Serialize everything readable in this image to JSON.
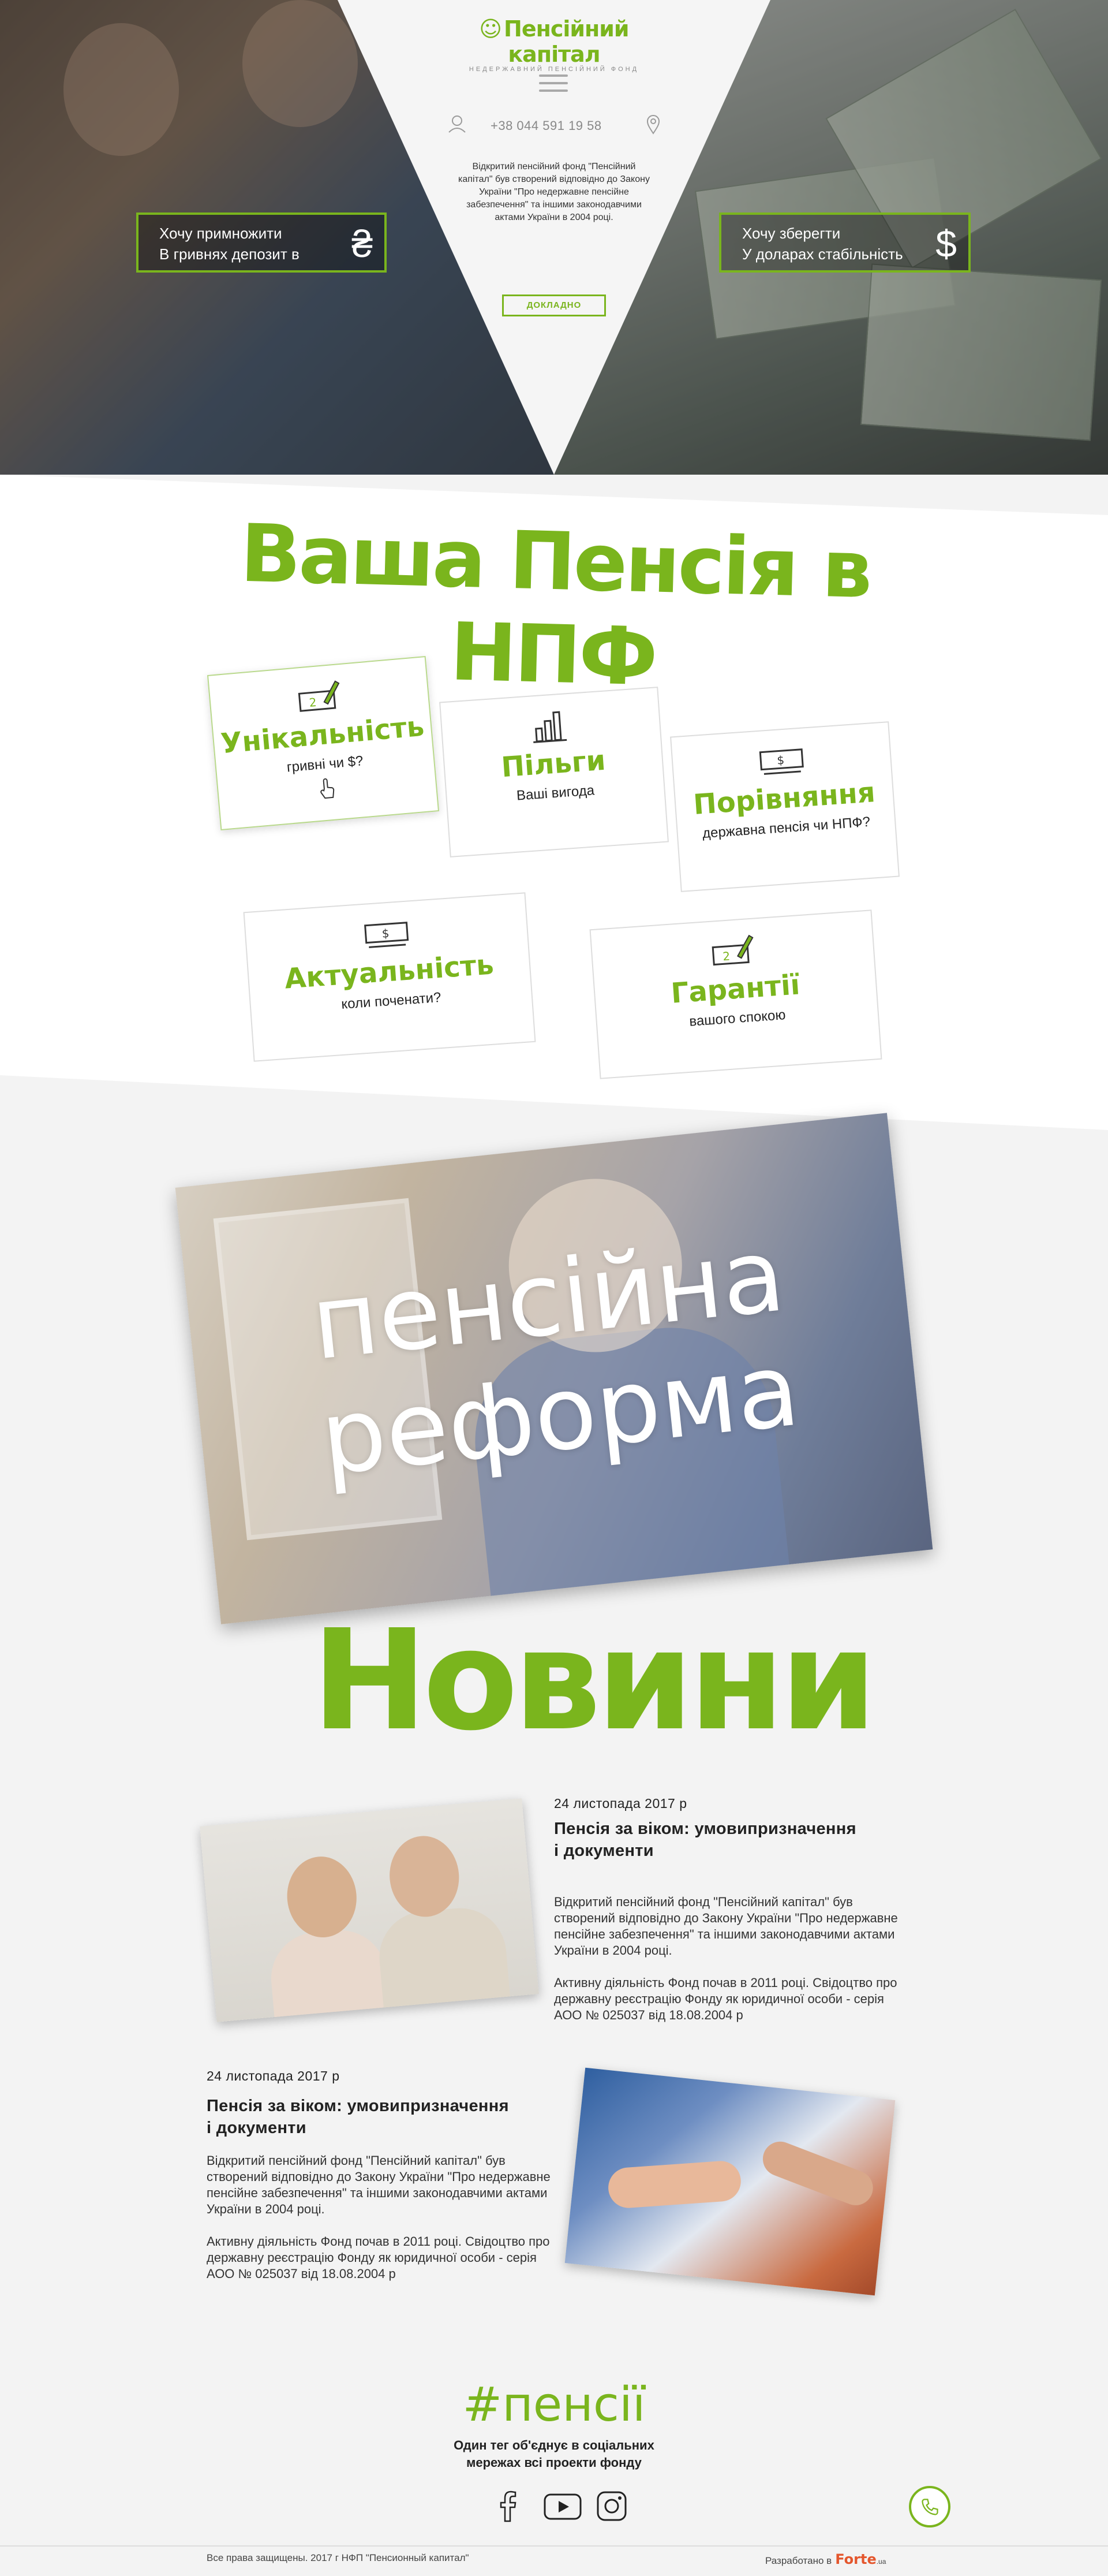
{
  "header": {
    "logo_title": "Пенсійний капітал",
    "logo_subtitle": "НЕДЕРЖАВНИЙ ПЕНСІЙНИЙ ФОНД",
    "phone": "+38 044 591 19 58",
    "description": "Відкритий пенсійний фонд \"Пенсійний капітал\" був створений відповідно до Закону України \"Про недержавне пенсійне забезпечення\" та іншими законодавчими актами України в 2004 році.",
    "more_button": "ДОКЛАДНО"
  },
  "hero": {
    "left_box": {
      "line1": "Хочу примножити",
      "line2": "В гривнях депозит в",
      "currency": "₴"
    },
    "right_box": {
      "line1": "Хочу зберегти",
      "line2": "У доларах стабільність",
      "currency": "$"
    }
  },
  "advantages": {
    "title": "Ваша Пенсія в НПФ",
    "cards": [
      {
        "title": "Унікальність",
        "subtitle": "гривні чи $?",
        "icon": "money-pen-icon"
      },
      {
        "title": "Пільги",
        "subtitle": "Ваші вигода",
        "icon": "bar-chart-icon"
      },
      {
        "title": "Порівняння",
        "subtitle": "державна пенсія чи НПФ?",
        "icon": "money-bill-icon"
      },
      {
        "title": "Актуальність",
        "subtitle": "коли поченати?",
        "icon": "money-bill-icon"
      },
      {
        "title": "Гарантії",
        "subtitle": "вашого спокою",
        "icon": "money-pen-icon"
      }
    ]
  },
  "reform": {
    "line1": "пенсійна",
    "line2": "реформа"
  },
  "news": {
    "title": "Новини",
    "items": [
      {
        "date": "24 листопада 2017 р",
        "title_line1": "Пенсія за віком: умовипризначення",
        "title_line2": "і документи",
        "p1": "Відкритий пенсійний фонд \"Пенсійний капітал\" був створений відповідно до Закону України \"Про недержавне пенсійне забезпечення\" та іншими законодавчими актами України в 2004 році.",
        "p2": "Активну діяльність Фонд почав в 2011 році. Свідоцтво про державну реєстрацію Фонду як юридичної особи - серія АОО № 025037 від 18.08.2004 р"
      },
      {
        "date": "24 листопада 2017 р",
        "title_line1": "Пенсія за віком: умовипризначення",
        "title_line2": "і документи",
        "p1": "Відкритий пенсійний фонд \"Пенсійний капітал\" був створений відповідно до Закону України \"Про недержавне пенсійне забезпечення\" та іншими законодавчими актами України в 2004 році.",
        "p2": "Активну діяльність Фонд почав в 2011 році. Свідоцтво про державну реєстрацію Фонду як юридичної особи - серія АОО № 025037 від 18.08.2004 р"
      }
    ]
  },
  "social": {
    "hashtag": "#пенсії",
    "text_line1": "Один тег об'єднує в соціальних",
    "text_line2": "мережах всі проекти фонду",
    "icons": [
      "facebook-icon",
      "youtube-icon",
      "instagram-icon"
    ]
  },
  "footer": {
    "copyright": "Все права защищены. 2017 г НФП \"Пенсионный капитал\"",
    "developed_by": "Разработано в",
    "developer": "Forte",
    "developer_suffix": ".ua"
  },
  "colors": {
    "accent": "#7ab51d",
    "developer": "#e4572e"
  }
}
